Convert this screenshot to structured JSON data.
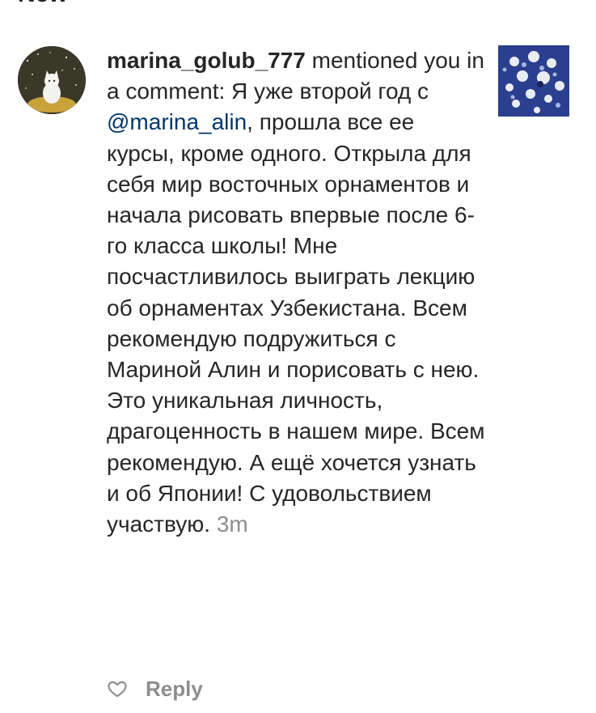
{
  "header": {
    "title": "New"
  },
  "notification": {
    "username": "marina_golub_777",
    "action_text": " mentioned you in a comment: Я уже второй год с ",
    "mention": "@marina_alin",
    "comment_text": ", прошла все ее курсы, кроме одного. Открыла для себя мир восточных орнаментов и начала рисовать впервые после 6-го класса школы! Мне посчастливилось выиграть лекцию об орнаментах Узбекистана. Всем рекомендую подружиться с Мариной Алин и порисовать с нею. Это уникальная личность, драгоценность в нашем мире. Всем рекомендую. А ещё хочется узнать и об Японии! С удовольствием участвую.",
    "timestamp": "3m",
    "avatar_icon": "avatar-cat-icon",
    "thumbnail_icon": "post-thumbnail-icon"
  },
  "actions": {
    "like_icon": "heart-icon",
    "reply_label": "Reply"
  },
  "colors": {
    "text": "#262626",
    "mention": "#00376b",
    "muted": "#8e8e8e"
  }
}
